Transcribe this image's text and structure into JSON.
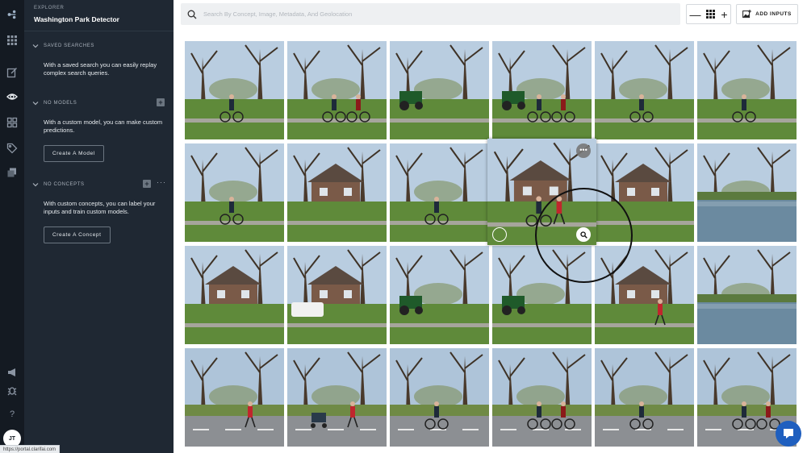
{
  "rail": {
    "icons": [
      "logo-icon",
      "apps-grid-icon",
      "edit-icon",
      "eye-icon",
      "dashboard-icon",
      "tag-icon",
      "copy-icon",
      "megaphone-icon",
      "bug-icon",
      "help-icon"
    ],
    "help_label": "?",
    "avatar_initials": "JT"
  },
  "sidebar": {
    "eyebrow": "Explorer",
    "project_title": "Washington Park Detector",
    "saved_searches": {
      "heading": "Saved Searches",
      "text": "With a saved search you can easily replay complex search queries."
    },
    "models": {
      "heading": "No Models",
      "text": "With a custom model, you can make custom predictions.",
      "button": "Create A Model"
    },
    "concepts": {
      "heading": "No Concepts",
      "text": "With custom concepts, you can label your inputs and train custom models.",
      "button": "Create A Concept"
    }
  },
  "status_url": "https://portal.clarifai.com",
  "topbar": {
    "search_placeholder": "Search By Concept, Image, Metadata, And Geolocation",
    "zoom_out": "—",
    "zoom_in": "+",
    "add_inputs_label": "Add Inputs"
  },
  "colors": {
    "rail_bg": "#141a22",
    "sidebar_bg": "#1f2833",
    "accent_blue": "#1f5fbf"
  },
  "grid": {
    "tiles": [
      {
        "scene": "cyclist"
      },
      {
        "scene": "two-cyclists"
      },
      {
        "scene": "tractor"
      },
      {
        "scene": "cyclists-tractor"
      },
      {
        "scene": "cyclist"
      },
      {
        "scene": "cyclist"
      },
      {
        "scene": "cyclist"
      },
      {
        "scene": "house"
      },
      {
        "scene": "cyclist"
      },
      {
        "scene": "house-hover"
      },
      {
        "scene": "house"
      },
      {
        "scene": "lake"
      },
      {
        "scene": "house"
      },
      {
        "scene": "house-van"
      },
      {
        "scene": "tractor"
      },
      {
        "scene": "tractor"
      },
      {
        "scene": "house-runner"
      },
      {
        "scene": "lake"
      },
      {
        "scene": "runner"
      },
      {
        "scene": "stroller"
      },
      {
        "scene": "road-cyclist"
      },
      {
        "scene": "road-cyclists"
      },
      {
        "scene": "road-cyclist"
      },
      {
        "scene": "road-cyclists"
      }
    ]
  }
}
